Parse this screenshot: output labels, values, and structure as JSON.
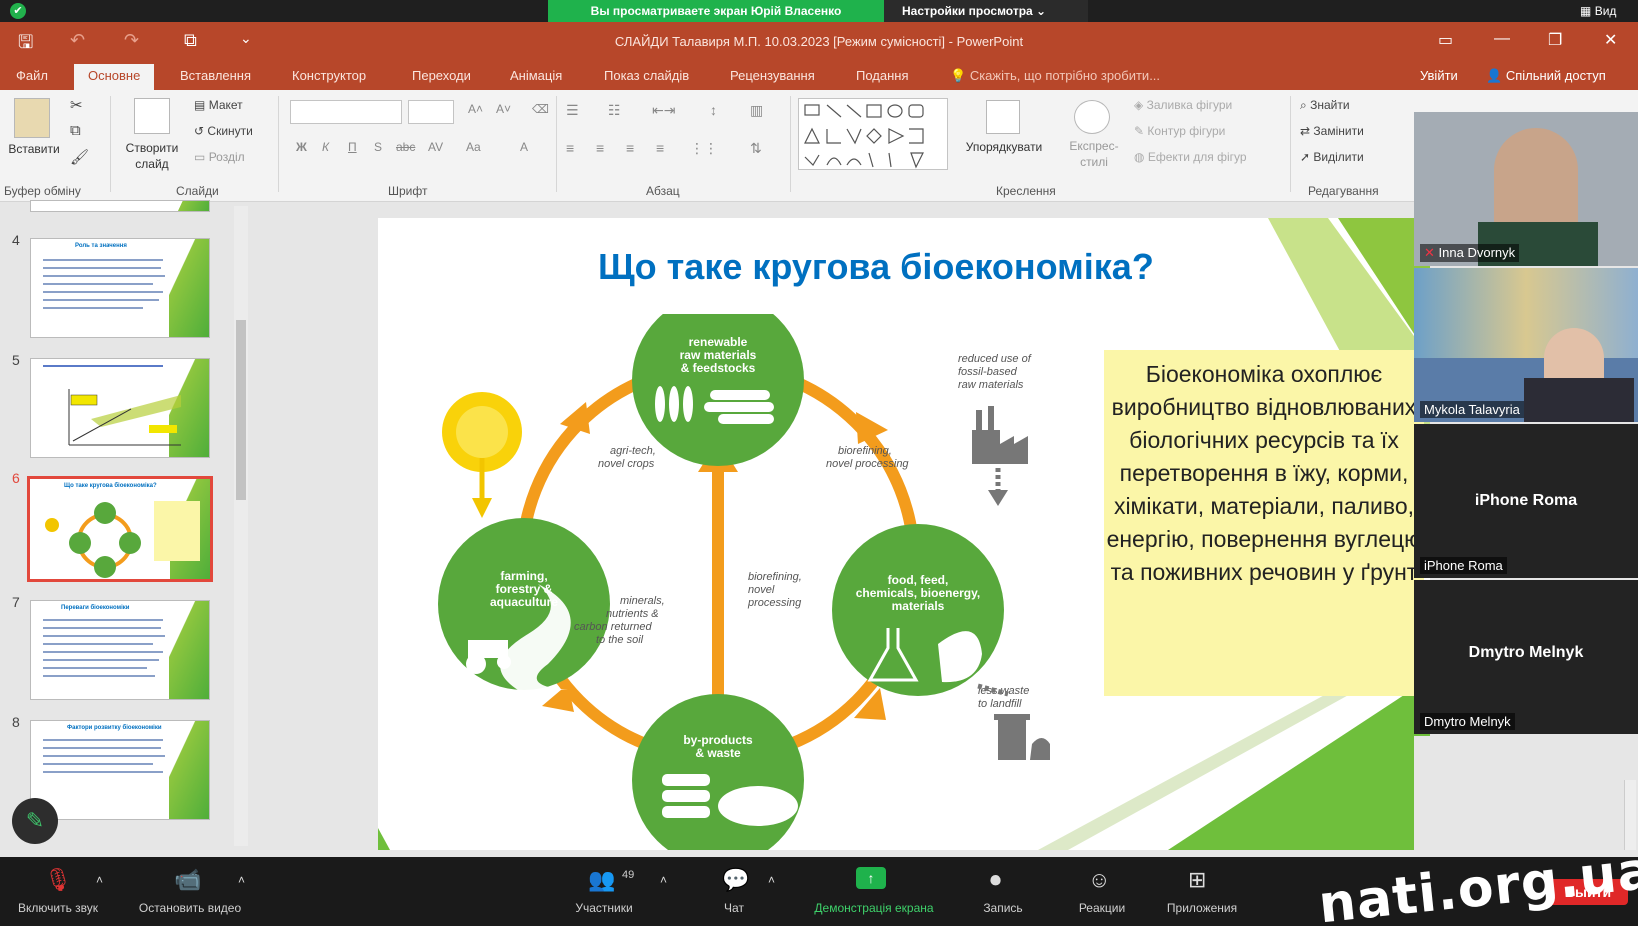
{
  "zoom_top": {
    "share_status": "Вы просматриваете экран Юрій Власенко",
    "view_options": "Настройки просмотра",
    "view_label": "Вид"
  },
  "ppt": {
    "window_title": "СЛАЙДИ Талавиря М.П. 10.03.2023 [Режим сумісності] - PowerPoint",
    "tabs": [
      "Файл",
      "Основне",
      "Вставлення",
      "Конструктор",
      "Переходи",
      "Анімація",
      "Показ слайдів",
      "Рецензування",
      "Подання"
    ],
    "tell_me": "Скажіть, що потрібно зробити...",
    "sign_in": "Увійти",
    "share": "Спільний доступ",
    "ribbon": {
      "paste": "Вставити",
      "clipboard": "Буфер обміну",
      "new_slide": "Створити слайд",
      "layout": "Макет",
      "reset": "Скинути",
      "section": "Розділ",
      "slides_group": "Слайди",
      "font_group": "Шрифт",
      "paragraph_group": "Абзац",
      "arrange": "Упорядкувати",
      "quick_styles": "Експрес-стилі",
      "shape_fill": "Заливка фігури",
      "shape_outline": "Контур фігури",
      "shape_effects": "Ефекти для фігур",
      "drawing_group": "Креслення",
      "find": "Знайти",
      "replace": "Замінити",
      "select": "Виділити",
      "editing_group": "Редагування",
      "font_buttons": [
        "Ж",
        "К",
        "П",
        "S",
        "abc",
        "AV",
        "Aa",
        "A"
      ]
    },
    "thumbnails": [
      {
        "num": "4",
        "title": "Роль та значення"
      },
      {
        "num": "5",
        "title": ""
      },
      {
        "num": "6",
        "title": "Що таке кругова біоекономіка?"
      },
      {
        "num": "7",
        "title": "Переваги біоекономіки"
      },
      {
        "num": "8",
        "title": "Фактори розвитку біоекономіки"
      }
    ],
    "slide": {
      "title": "Що таке кругова біоекономіка?",
      "text": "Біоекономіка охоплює виробництво відновлюваних біологічних ресурсів та їх перетворення в їжу, корми, хімікати, матеріали, паливо, енергію, повернення вуглецю та поживних речовин у ґрунт",
      "diagram": {
        "node_top": "renewable raw materials & feedstocks",
        "node_left": "farming, forestry & aquaculture",
        "node_right": "food, feed, chemicals, bioenergy, materials",
        "node_bottom": "by-products & waste",
        "label_agri": "agri-tech, novel crops",
        "label_biorefining_top": "biorefining, novel processing",
        "label_biorefining_mid": "biorefining, novel processing",
        "label_minerals": "minerals, nutrients & carbon returned to the soil",
        "label_fossil": "reduced use of fossil-based raw materials",
        "label_landfill": "less waste to landfill"
      }
    }
  },
  "participants": [
    {
      "name": "Inna Dvornyk",
      "big": ""
    },
    {
      "name": "Mykola Talavyria",
      "big": ""
    },
    {
      "name": "iPhone Roma",
      "big": "iPhone Roma"
    },
    {
      "name": "Dmytro Melnyk",
      "big": "Dmytro Melnyk"
    }
  ],
  "zoom_bar": {
    "mute": "Включить звук",
    "video": "Остановить видео",
    "participants": "Участники",
    "participants_count": "49",
    "chat": "Чат",
    "share": "Демонстрація екрана",
    "record": "Запись",
    "reactions": "Реакции",
    "apps": "Приложения",
    "leave": "Выйти"
  },
  "watermark": "nati.org.ua",
  "colors": {
    "ppt_accent": "#b7472a",
    "zoom_green": "#1fb24c",
    "slide_title": "#0070c0",
    "leave_red": "#e02828"
  }
}
